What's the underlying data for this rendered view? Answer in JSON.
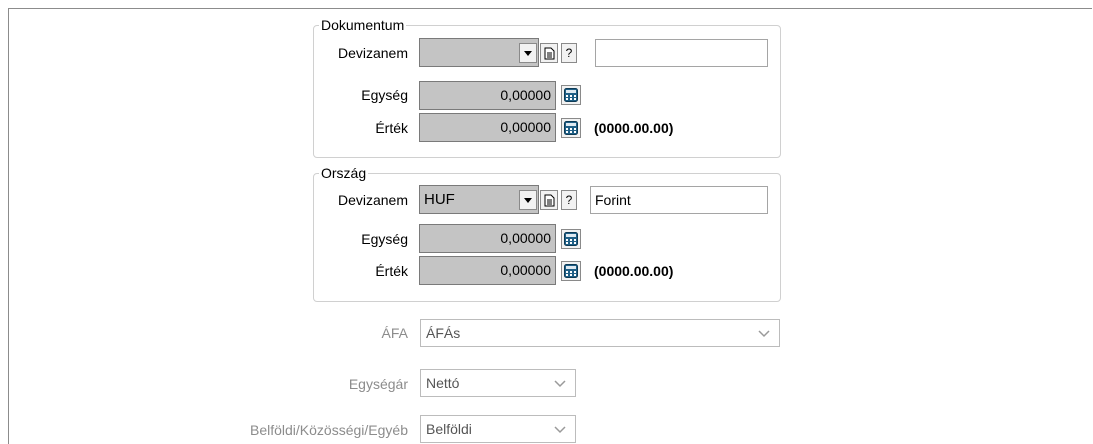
{
  "dokumentum": {
    "legend": "Dokumentum",
    "devizanem_label": "Devizanem",
    "devizanem_value": "",
    "devizanem_name": "",
    "egyseg_label": "Egység",
    "egyseg_value": "0,00000",
    "ertek_label": "Érték",
    "ertek_value": "0,00000",
    "date": "(0000.00.00)"
  },
  "orszag": {
    "legend": "Ország",
    "devizanem_label": "Devizanem",
    "devizanem_value": "HUF",
    "devizanem_name": "Forint",
    "egyseg_label": "Egység",
    "egyseg_value": "0,00000",
    "ertek_label": "Érték",
    "ertek_value": "0,00000",
    "date": "(0000.00.00)"
  },
  "help_button_label": "?",
  "afa": {
    "label": "ÁFA",
    "value": "ÁFÁs"
  },
  "egysegar": {
    "label": "Egységár",
    "value": "Nettó"
  },
  "belfoldi": {
    "label": "Belföldi/Közösségi/Egyéb",
    "value": "Belföldi"
  }
}
